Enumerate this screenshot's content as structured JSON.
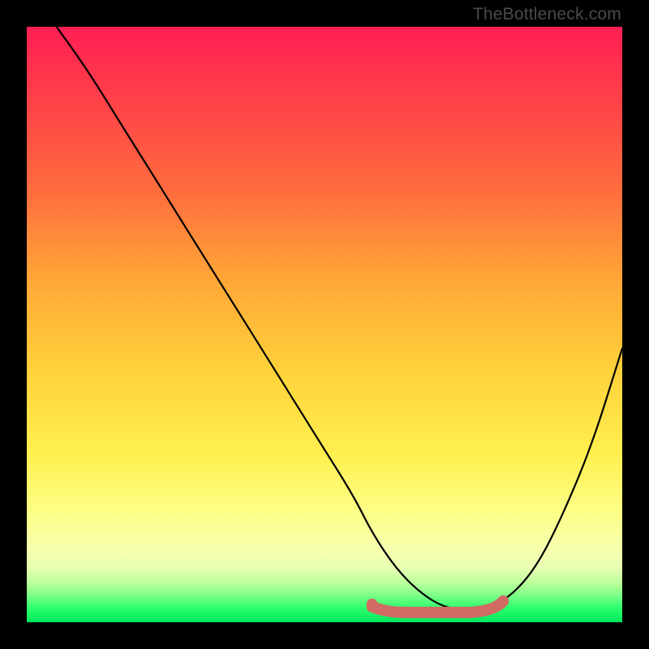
{
  "attribution": "TheBottleneck.com",
  "chart_data": {
    "type": "line",
    "title": "",
    "xlabel": "",
    "ylabel": "",
    "xlim": [
      0,
      100
    ],
    "ylim": [
      0,
      100
    ],
    "series": [
      {
        "name": "bottleneck-curve",
        "x": [
          5,
          10,
          15,
          20,
          25,
          30,
          35,
          40,
          45,
          50,
          55,
          58,
          62,
          66,
          70,
          74,
          78,
          82,
          86,
          90,
          95,
          100
        ],
        "values": [
          100,
          93,
          85,
          77,
          69,
          61,
          53,
          45,
          37,
          29,
          21,
          15,
          9,
          5,
          2.5,
          2,
          2.5,
          5,
          10,
          18,
          30,
          46
        ]
      }
    ],
    "highlight": {
      "name": "optimal-range",
      "color": "#d16a63",
      "x_start": 58,
      "x_end": 80,
      "y": 2.2
    },
    "background_gradient": {
      "top": "#ff1f54",
      "mid": "#ffd23a",
      "bottom": "#00e95e"
    }
  }
}
